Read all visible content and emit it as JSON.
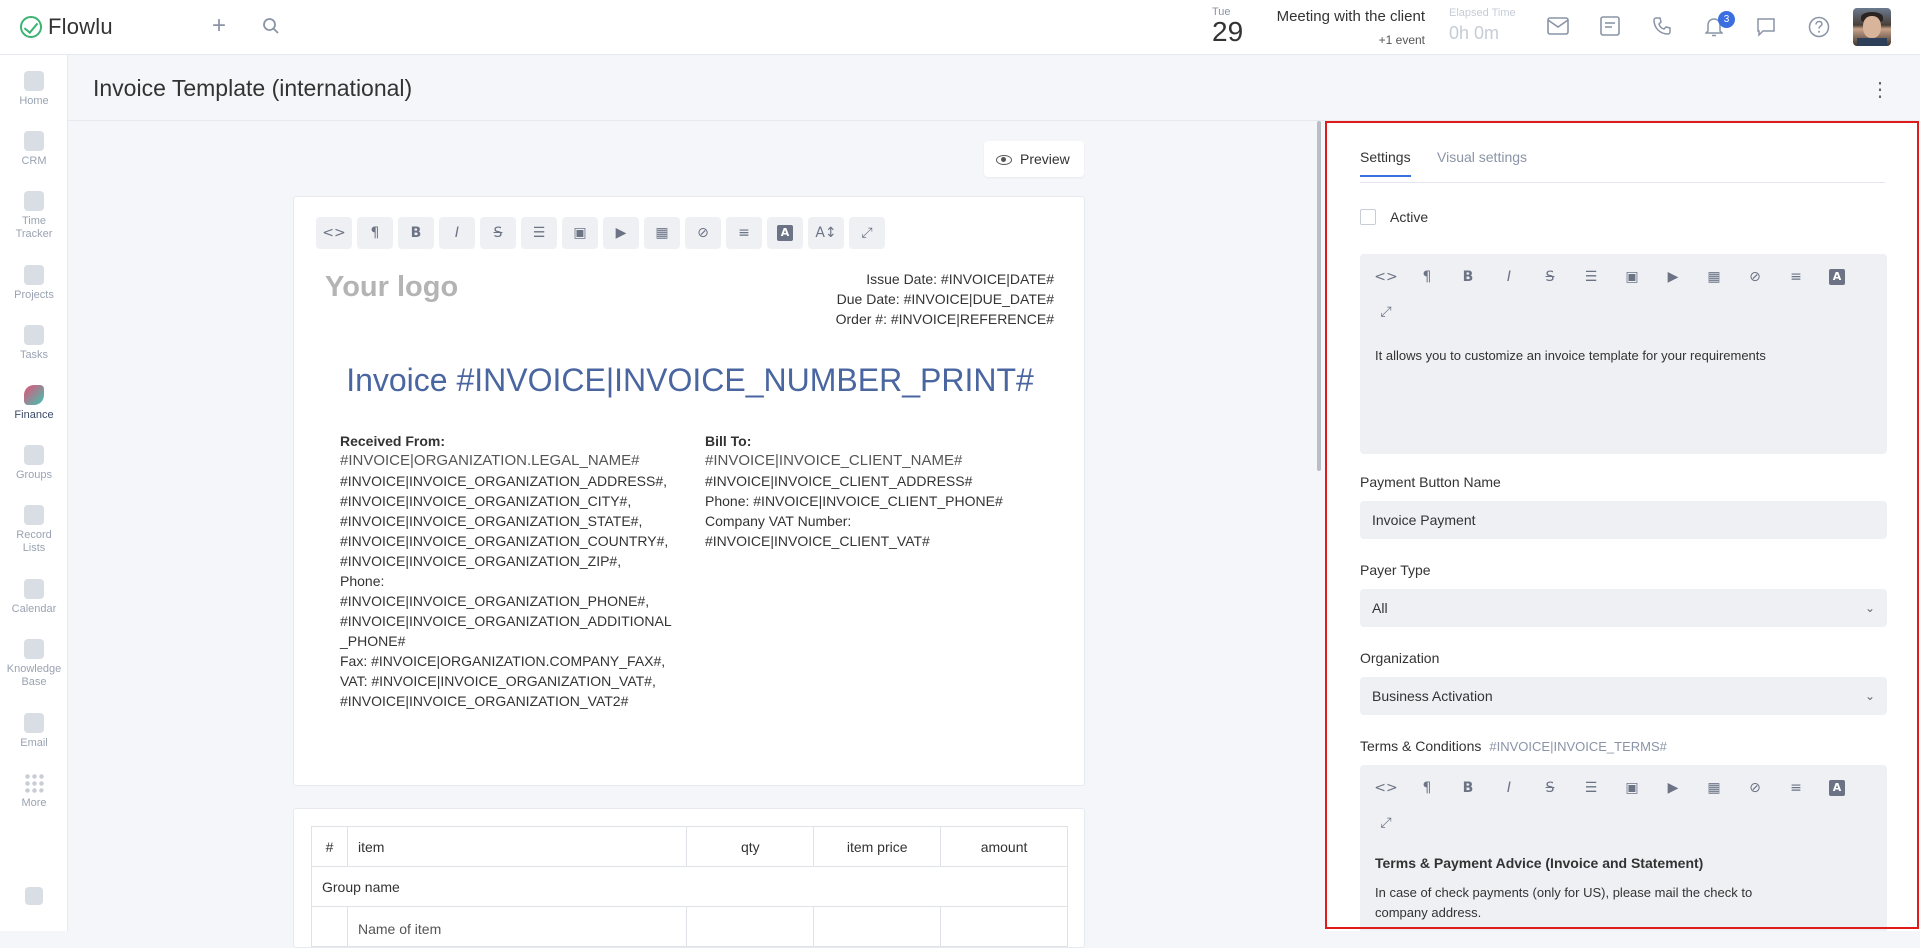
{
  "app": {
    "name": "Flowlu"
  },
  "topbar": {
    "date_dow": "Tue",
    "date_day": "29",
    "meeting_title": "Meeting with the client",
    "meeting_sub": "+1 event",
    "elapsed_label": "Elapsed Time",
    "elapsed_value": "0h 0m",
    "notification_count": "3"
  },
  "sidebar": {
    "items": [
      {
        "label": "Home"
      },
      {
        "label": "CRM"
      },
      {
        "label": "Time Tracker"
      },
      {
        "label": "Projects"
      },
      {
        "label": "Tasks"
      },
      {
        "label": "Finance"
      },
      {
        "label": "Groups"
      },
      {
        "label": "Record Lists"
      },
      {
        "label": "Calendar"
      },
      {
        "label": "Knowledge Base"
      },
      {
        "label": "Email"
      },
      {
        "label": "More"
      }
    ]
  },
  "page": {
    "title": "Invoice Template (international)"
  },
  "editor": {
    "preview_label": "Preview",
    "logo_text": "Your logo",
    "issue_date": "Issue Date: #INVOICE|DATE#",
    "due_date": "Due Date: #INVOICE|DUE_DATE#",
    "order_no": "Order #: #INVOICE|REFERENCE#",
    "invoice_title": "Invoice #INVOICE|INVOICE_NUMBER_PRINT#",
    "received_from": {
      "heading": "Received From:",
      "name": "#INVOICE|ORGANIZATION.LEGAL_NAME#",
      "lines": [
        "#INVOICE|INVOICE_ORGANIZATION_ADDRESS#,",
        "#INVOICE|INVOICE_ORGANIZATION_CITY#,",
        "#INVOICE|INVOICE_ORGANIZATION_STATE#,",
        "#INVOICE|INVOICE_ORGANIZATION_COUNTRY#,",
        "#INVOICE|INVOICE_ORGANIZATION_ZIP#,",
        "Phone:",
        "#INVOICE|INVOICE_ORGANIZATION_PHONE#,",
        "#INVOICE|INVOICE_ORGANIZATION_ADDITIONAL",
        "_PHONE#",
        "Fax: #INVOICE|ORGANIZATION.COMPANY_FAX#,",
        "VAT: #INVOICE|INVOICE_ORGANIZATION_VAT#,",
        "#INVOICE|INVOICE_ORGANIZATION_VAT2#"
      ]
    },
    "bill_to": {
      "heading": "Bill To:",
      "name": "#INVOICE|INVOICE_CLIENT_NAME#",
      "lines": [
        "#INVOICE|INVOICE_CLIENT_ADDRESS#",
        "Phone: #INVOICE|INVOICE_CLIENT_PHONE#",
        "Company VAT Number:",
        "#INVOICE|INVOICE_CLIENT_VAT#"
      ]
    },
    "table": {
      "headers": [
        "#",
        "item",
        "qty",
        "item price",
        "amount"
      ],
      "group_row": "Group name",
      "item_row": "Name of item"
    }
  },
  "settings": {
    "tabs": [
      "Settings",
      "Visual settings"
    ],
    "active_label": "Active",
    "description": "It allows you to customize an invoice template for your requirements",
    "payment_button_label": "Payment Button Name",
    "payment_button_value": "Invoice Payment",
    "payer_type_label": "Payer Type",
    "payer_type_value": "All",
    "organization_label": "Organization",
    "organization_value": "Business Activation",
    "terms_label": "Terms & Conditions",
    "terms_hint": "#INVOICE|INVOICE_TERMS#",
    "terms_heading": "Terms & Payment Advice (Invoice and Statement)",
    "terms_body": "In case of check payments (only for US), please mail the check to",
    "terms_body2": "company address."
  },
  "colors": {
    "accent": "#3b6fe0",
    "invoice_title": "#4a66a0",
    "highlight": "#e01b1b"
  }
}
